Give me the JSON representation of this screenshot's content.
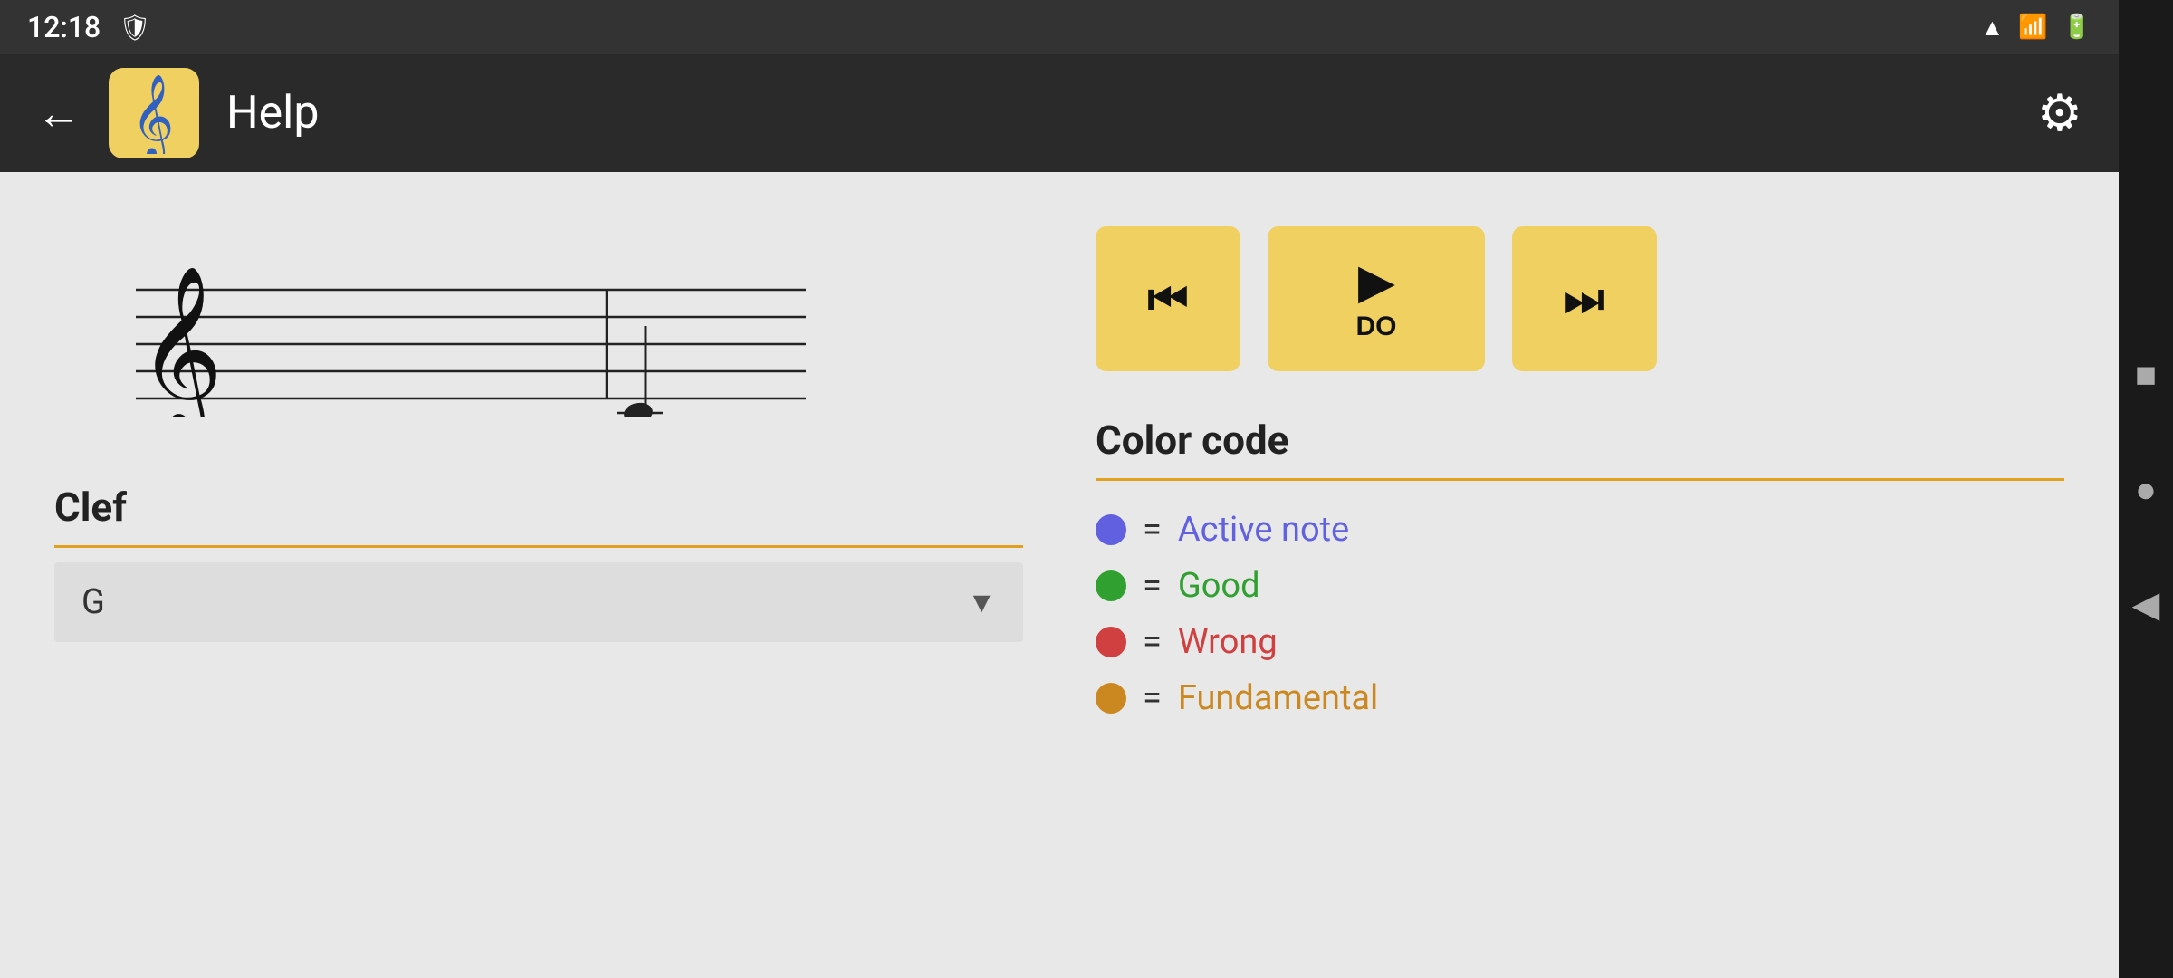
{
  "statusBar": {
    "time": "12:18",
    "iconShield": "🛡",
    "wifiIcon": "wifi",
    "signalIcon": "signal",
    "batteryIcon": "battery"
  },
  "topBar": {
    "backLabel": "←",
    "appIconEmoji": "𝄞",
    "title": "Help",
    "settingsLabel": "⚙"
  },
  "playback": {
    "prevLabel": "⏮",
    "playLabel": "▶",
    "playSubLabel": "DO",
    "nextLabel": "⏭"
  },
  "clef": {
    "sectionLabel": "Clef",
    "dropdownValue": "G",
    "dropdownArrow": "▼"
  },
  "colorCode": {
    "sectionLabel": "Color code",
    "items": [
      {
        "dotColor": "#6060e0",
        "equals": "=",
        "label": "Active note",
        "className": "color-label-active"
      },
      {
        "dotColor": "#30a030",
        "equals": "=",
        "label": "Good",
        "className": "color-label-good"
      },
      {
        "dotColor": "#d04040",
        "equals": "=",
        "label": "Wrong",
        "className": "color-label-wrong"
      },
      {
        "dotColor": "#cc8820",
        "equals": "=",
        "label": "Fundamental",
        "className": "color-label-fundamental"
      }
    ]
  },
  "navPanel": {
    "squareIcon": "■",
    "circleIcon": "●",
    "backIcon": "◀"
  }
}
